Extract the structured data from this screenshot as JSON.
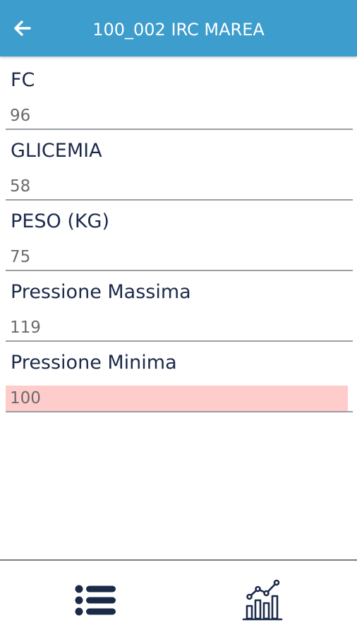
{
  "header": {
    "title": "100_002 IRC MAREA",
    "background": "#3d9dcc",
    "back_icon": "arrow-left-icon"
  },
  "measurements": [
    {
      "label": "FC",
      "value": "96",
      "alert": false
    },
    {
      "label": "GLICEMIA",
      "value": "58",
      "alert": false
    },
    {
      "label": "PESO (KG)",
      "value": "75",
      "alert": false
    },
    {
      "label": "Pressione Massima",
      "value": "119",
      "alert": false
    },
    {
      "label": "Pressione Minima",
      "value": "100",
      "alert": true
    }
  ],
  "colors": {
    "label_text": "#1c2a4a",
    "value_text": "#6b6b6b",
    "alert_background": "#ffcccc",
    "icon": "#1c2a4a"
  },
  "bottom_nav": {
    "tabs": [
      {
        "icon": "list-icon"
      },
      {
        "icon": "chart-icon"
      }
    ]
  }
}
